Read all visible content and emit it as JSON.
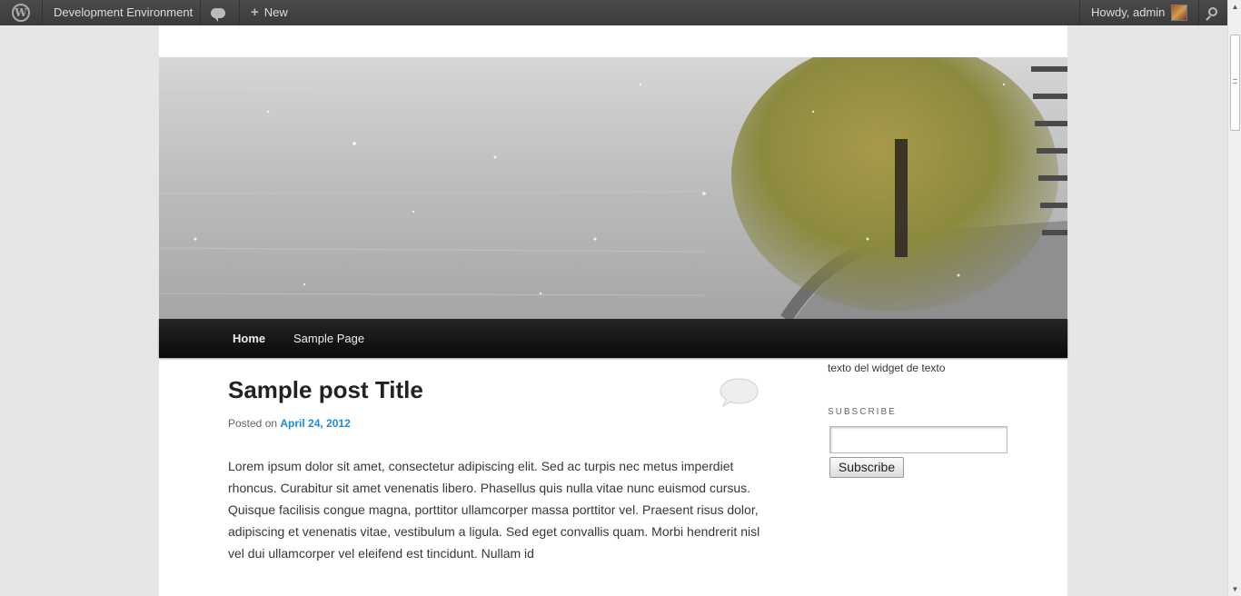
{
  "adminbar": {
    "site_name": "Development Environment",
    "new_label": "New",
    "howdy": "Howdy, admin"
  },
  "nav": {
    "items": [
      {
        "label": "Home"
      },
      {
        "label": "Sample Page"
      }
    ]
  },
  "post": {
    "title": "Sample post Title",
    "posted_on_prefix": "Posted on",
    "date": "April 24, 2012",
    "content": "Lorem ipsum dolor sit amet, consectetur adipiscing elit. Sed ac turpis nec metus imperdiet rhoncus. Curabitur sit amet venenatis libero. Phasellus quis nulla vitae nunc euismod cursus. Quisque facilisis congue magna, porttitor ullamcorper massa porttitor vel. Praesent risus dolor, adipiscing et venenatis vitae, vestibulum a ligula. Sed eget convallis quam. Morbi hendrerit nisl vel dui ullamcorper vel eleifend est tincidunt. Nullam id"
  },
  "sidebar": {
    "text_widget": "texto del widget de texto",
    "subscribe_title": "Subscribe",
    "subscribe_input_value": "",
    "subscribe_button": "Subscribe"
  },
  "colors": {
    "adminbar_bg": "#464646",
    "nav_bg": "#111111",
    "link": "#1b8be0"
  },
  "icons": [
    "wordpress-logo-icon",
    "comment-bubble-icon",
    "plus-icon",
    "search-icon"
  ]
}
